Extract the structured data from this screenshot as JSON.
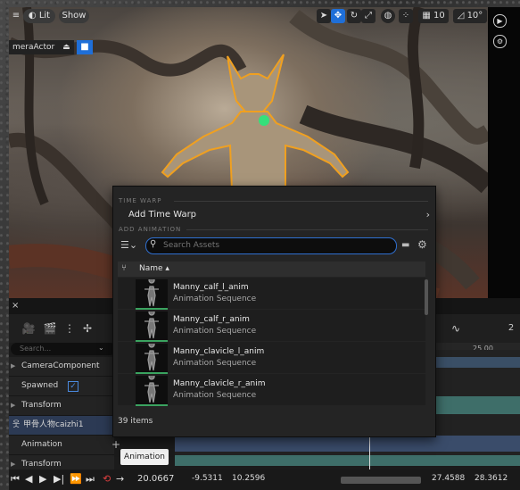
{
  "viewport": {
    "lit_label": "Lit",
    "show_label": "Show",
    "camera_actor_label": "meraActor",
    "grid_value": "10",
    "angle_value": "10°"
  },
  "sequencer": {
    "tab_close": "×",
    "search_placeholder": "Search...",
    "tracks": [
      {
        "label": "CameraComponent"
      },
      {
        "label": "Spawned"
      },
      {
        "label": "Transform"
      },
      {
        "label": "甲骨人物caizhi1"
      },
      {
        "label": "Animation"
      },
      {
        "label": "Transform"
      }
    ],
    "ruler_tick": "25.00",
    "tooltip": "Animation",
    "add_symbol": "+",
    "frame_value": "20.0667",
    "range": [
      "-9.5311",
      "10.2596",
      "27.4588",
      "28.3612"
    ],
    "right_label": "2"
  },
  "popup": {
    "time_warp_section": "TIME WARP",
    "add_time_warp": "Add Time Warp",
    "add_animation_section": "ADD ANIMATION",
    "search_placeholder": "Search Assets",
    "column_name": "Name",
    "assets": [
      {
        "name": "Manny_calf_l_anim",
        "type": "Animation Sequence"
      },
      {
        "name": "Manny_calf_r_anim",
        "type": "Animation Sequence"
      },
      {
        "name": "Manny_clavicle_l_anim",
        "type": "Animation Sequence"
      },
      {
        "name": "Manny_clavicle_r_anim",
        "type": "Animation Sequence"
      }
    ],
    "items_count": "39 items"
  },
  "colors": {
    "accent": "#1f6fd8",
    "track_lane": "#3e6e69",
    "thumb_border": "#3aa35f",
    "selection_outline": "#f0a020"
  }
}
